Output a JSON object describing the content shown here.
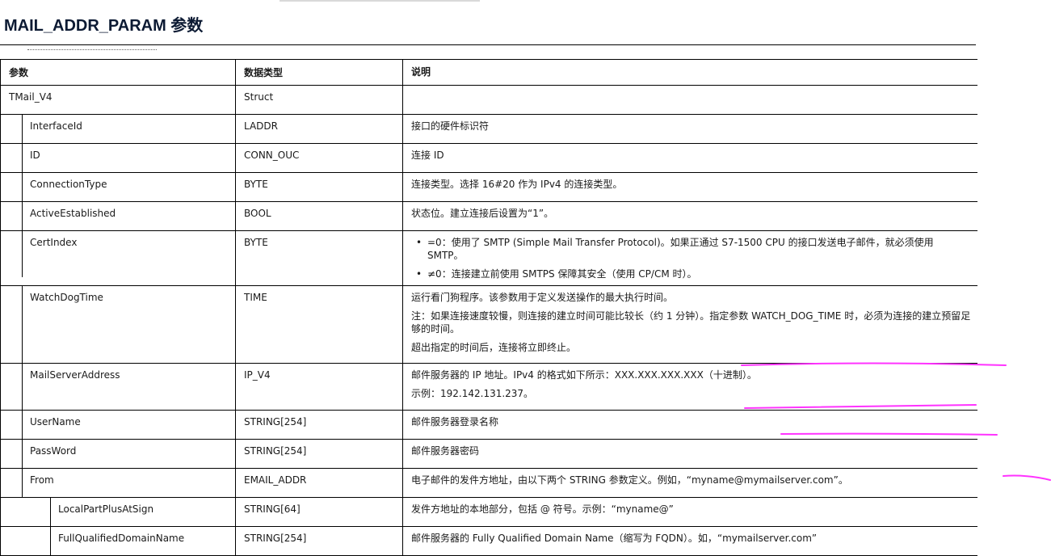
{
  "title": "MAIL_ADDR_PARAM 参数",
  "table": {
    "headers": [
      "参数",
      "数据类型",
      "说明"
    ],
    "rows": [
      {
        "level": 0,
        "name": "TMail_V4",
        "type": "Struct",
        "desc": []
      },
      {
        "level": 1,
        "name": "InterfaceId",
        "type": "LADDR",
        "desc": [
          "接口的硬件标识符"
        ]
      },
      {
        "level": 1,
        "name": "ID",
        "type": "CONN_OUC",
        "desc": [
          "连接 ID"
        ]
      },
      {
        "level": 1,
        "name": "ConnectionType",
        "type": "BYTE",
        "desc": [
          "连接类型。选择 16#20 作为 IPv4 的连接类型。"
        ]
      },
      {
        "level": 1,
        "name": "ActiveEstablished",
        "type": "BOOL",
        "desc": [
          "状态位。建立连接后设置为“1”。"
        ]
      },
      {
        "level": 1,
        "name": "CertIndex",
        "type": "BYTE",
        "bullets": [
          "=0：使用了 SMTP (Simple Mail Transfer Protocol)。如果正通过 S7-1500 CPU 的接口发送电子邮件，就必须使用 SMTP。",
          "≠0：连接建立前使用 SMTPS 保障其安全（使用 CP/CM 时）。"
        ]
      },
      {
        "level": 1,
        "name": "WatchDogTime",
        "type": "TIME",
        "desc": [
          "运行看门狗程序。该参数用于定义发送操作的最大执行时间。",
          "注：如果连接速度较慢，则连接的建立时间可能比较长（约 1 分钟）。指定参数 WATCH_DOG_TIME 时，必须为连接的建立预留足够的时间。",
          "超出指定的时间后，连接将立即终止。"
        ]
      },
      {
        "level": 1,
        "name": "MailServerAddress",
        "type": "IP_V4",
        "desc": [
          "邮件服务器的 IP 地址。IPv4 的格式如下所示：XXX.XXX.XXX.XXX（十进制）。",
          "示例：192.142.131.237。"
        ]
      },
      {
        "level": 1,
        "name": "UserName",
        "type": "STRING[254]",
        "desc": [
          "邮件服务器登录名称"
        ]
      },
      {
        "level": 1,
        "name": "PassWord",
        "type": "STRING[254]",
        "desc": [
          "邮件服务器密码"
        ]
      },
      {
        "level": 1,
        "name": "From",
        "type": "EMAIL_ADDR",
        "desc": [
          "电子邮件的发件方地址，由以下两个 STRING 参数定义。例如，“myname@mymailserver.com”。"
        ]
      },
      {
        "level": 2,
        "name": "LocalPartPlusAtSign",
        "type": "STRING[64]",
        "desc": [
          "发件方地址的本地部分，包括 @ 符号。示例：“myname@”"
        ]
      },
      {
        "level": 2,
        "name": "FullQualifiedDomainName",
        "type": "STRING[254]",
        "desc": [
          "邮件服务器的 Fully Qualified Domain Name（缩写为 FQDN）。如，“mymailserver.com”"
        ]
      }
    ]
  },
  "colors": {
    "annotation": "#ff33ff",
    "title": "#0c1a33"
  }
}
